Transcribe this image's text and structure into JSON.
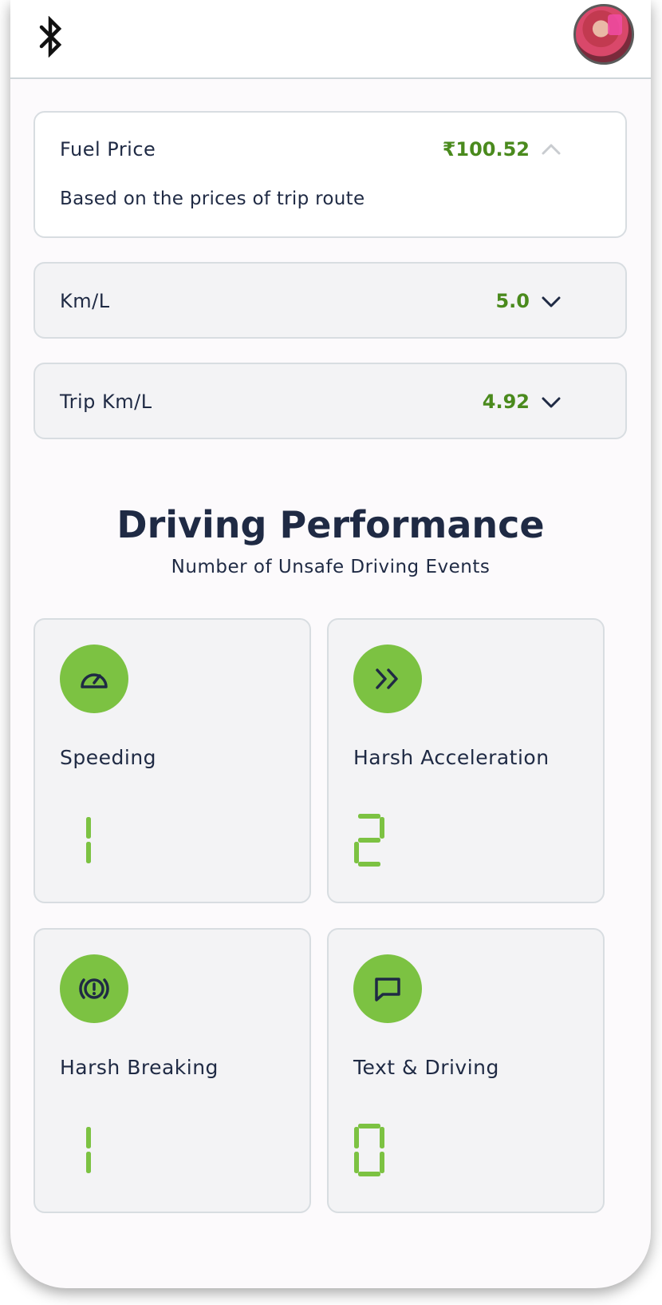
{
  "header": {
    "bluetooth_icon": "bluetooth-icon",
    "avatar": "user-avatar"
  },
  "fuel_price": {
    "label": "Fuel Price",
    "value": "₹100.52",
    "description": "Based on the prices of trip route",
    "expanded": true
  },
  "km_per_l": {
    "label": "Km/L",
    "value": "5.0",
    "expanded": false
  },
  "trip_km_per_l": {
    "label": "Trip Km/L",
    "value": "4.92",
    "expanded": false
  },
  "driving_performance": {
    "title": "Driving Performance",
    "subtitle": "Number of Unsafe Driving Events",
    "events": [
      {
        "label": "Speeding",
        "count": 1,
        "icon": "speedometer-icon"
      },
      {
        "label": "Harsh Acceleration",
        "count": 2,
        "icon": "fast-forward-icon"
      },
      {
        "label": "Harsh Breaking",
        "count": 1,
        "icon": "brake-warning-icon"
      },
      {
        "label": "Text & Driving",
        "count": 0,
        "icon": "message-icon"
      }
    ]
  },
  "colors": {
    "accent_green": "#7cc242",
    "value_green": "#4a8a1d",
    "text_dark": "#1f2a44"
  }
}
